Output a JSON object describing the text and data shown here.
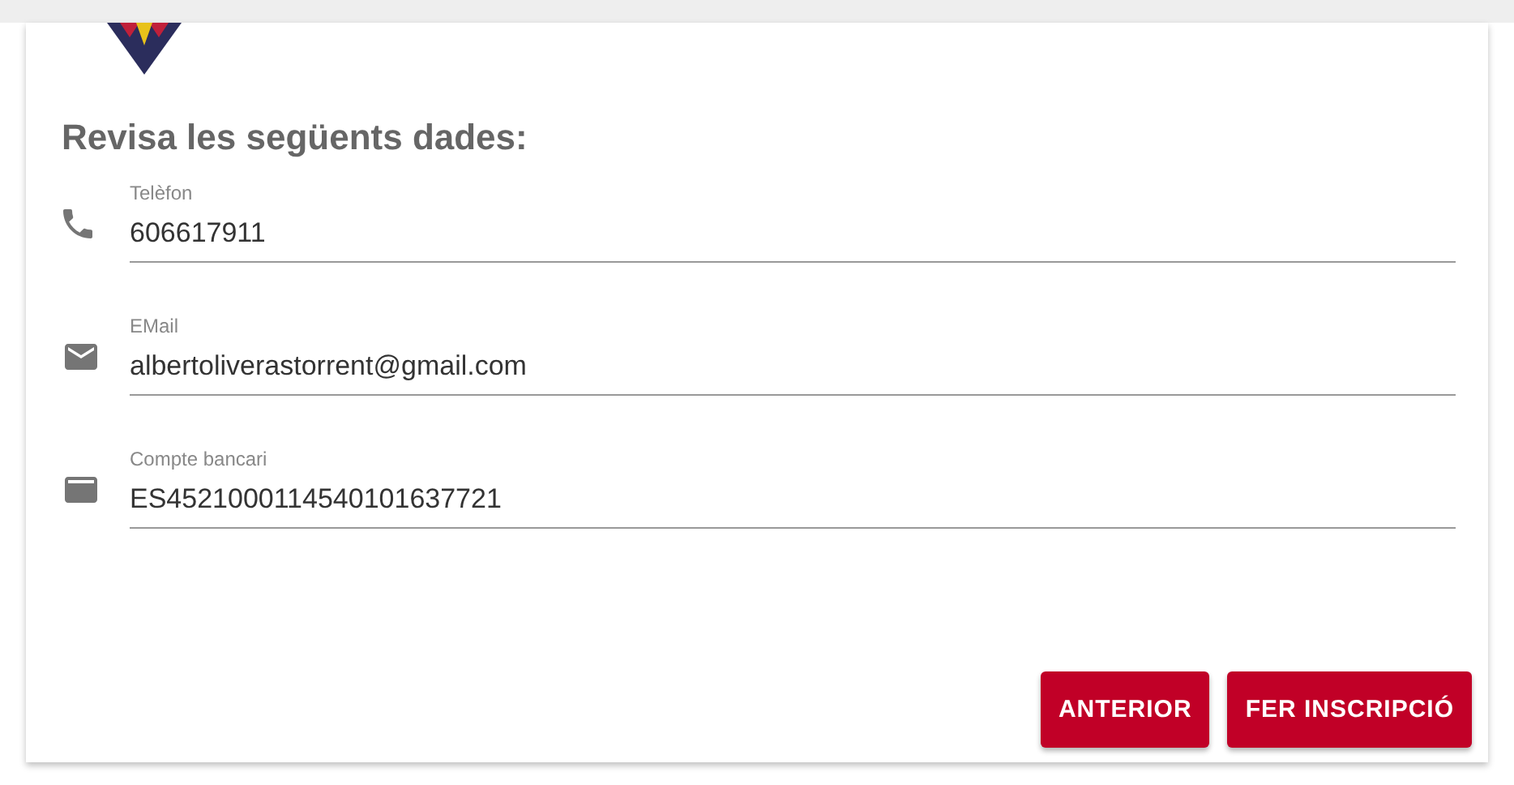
{
  "heading": "Revisa les següents dades:",
  "fields": [
    {
      "kind": "phone",
      "label": "Telèfon",
      "value": "606617911"
    },
    {
      "kind": "email",
      "label": "EMail",
      "value": "albertoliverastorrent@gmail.com"
    },
    {
      "kind": "card",
      "label": "Compte bancari",
      "value": "ES4521000114540101637721"
    }
  ],
  "buttons": [
    "ANTERIOR",
    "FER INSCRIPCIÓ"
  ]
}
